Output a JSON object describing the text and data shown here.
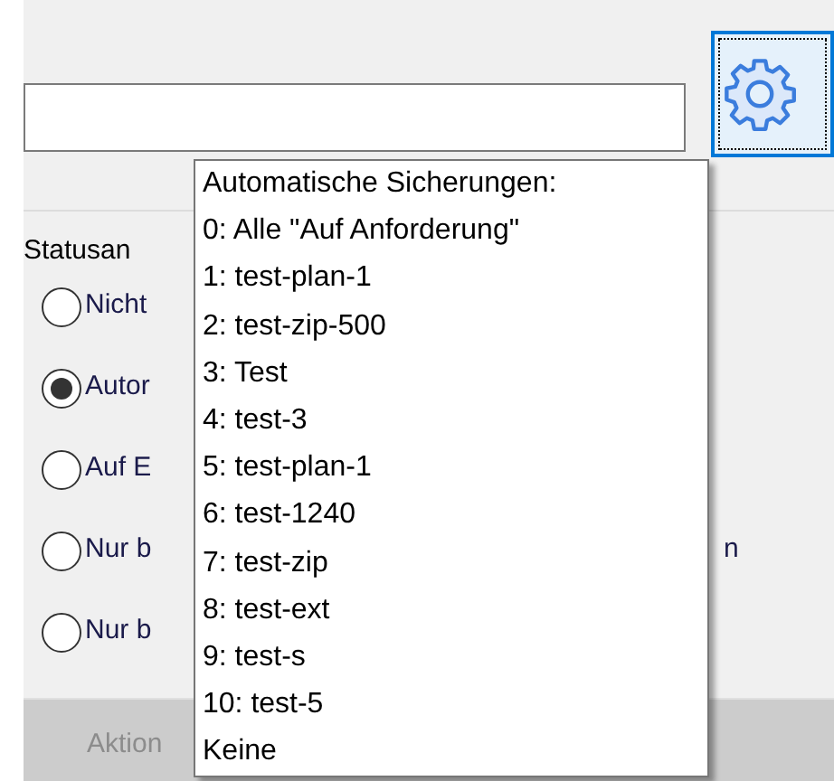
{
  "settings_button": {
    "focused": true
  },
  "status_group": {
    "label": "Statusan"
  },
  "radios": [
    {
      "label": "Nicht",
      "selected": false
    },
    {
      "label": "Autor",
      "selected": true
    },
    {
      "label": "Auf E",
      "selected": false
    },
    {
      "label": "Nur b",
      "label_end": "n",
      "selected": false
    },
    {
      "label": "Nur b",
      "selected": false
    }
  ],
  "action_bar": {
    "label": "Aktion",
    "disabled": true
  },
  "tooltip": {
    "lines": [
      "Automatische Sicherungen:",
      "0: Alle \"Auf Anforderung\"",
      "1: test-plan-1",
      "2: test-zip-500",
      "3: Test",
      "4: test-3",
      "5: test-plan-1",
      "6: test-1240",
      "7: test-zip",
      "8: test-ext",
      "9: test-s",
      "10: test-5",
      "Keine"
    ]
  }
}
